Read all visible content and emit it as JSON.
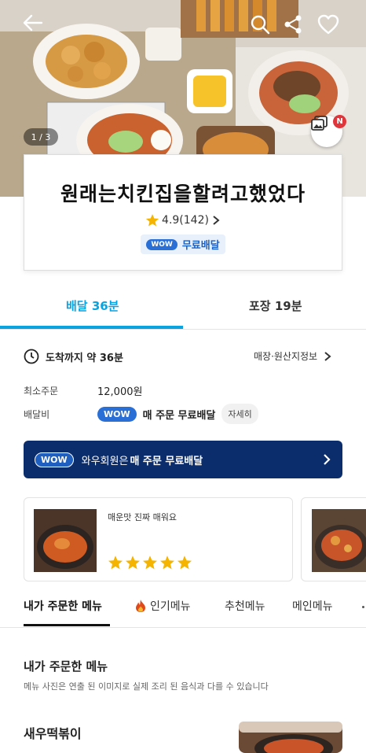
{
  "hero": {
    "pager": "1 / 3",
    "photo_badge": "N"
  },
  "store": {
    "name": "원래는치킨집을할려고했었다",
    "rating": "4.9(142)",
    "wow_pill": "WOW",
    "free_delivery": "무료배달"
  },
  "tabs": {
    "delivery": "배달 36분",
    "pickup": "포장 19분"
  },
  "info": {
    "eta": "도착까지 약 36분",
    "store_info": "매장·원산지정보",
    "min_order_label": "최소주문",
    "min_order_value": "12,000원",
    "fee_label": "배달비",
    "wow_pill": "WOW",
    "fee_text": "매 주문 무료배달",
    "details": "자세히"
  },
  "banner": {
    "pill": "WOW",
    "text_prefix": "와우회원은 ",
    "text_bold": "매 주문 무료배달"
  },
  "review": {
    "text": "매운맛 진짜 매워요",
    "stars": 5
  },
  "menu_tabs": [
    "내가 주문한 메뉴",
    "인기메뉴",
    "추천메뉴",
    "메인메뉴"
  ],
  "section": {
    "title": "내가 주문한 메뉴",
    "note": "메뉴 사진은 연출 된 이미지로 실제 조리 된 음식과 다를 수 있습니다"
  },
  "item": {
    "name": "새우떡볶이"
  },
  "colors": {
    "accent": "#0aa3e0",
    "wow_blue": "#2a6fd6",
    "banner_bg": "#0c2d6b",
    "star": "#f5b400",
    "hot": "#e04a1a"
  }
}
